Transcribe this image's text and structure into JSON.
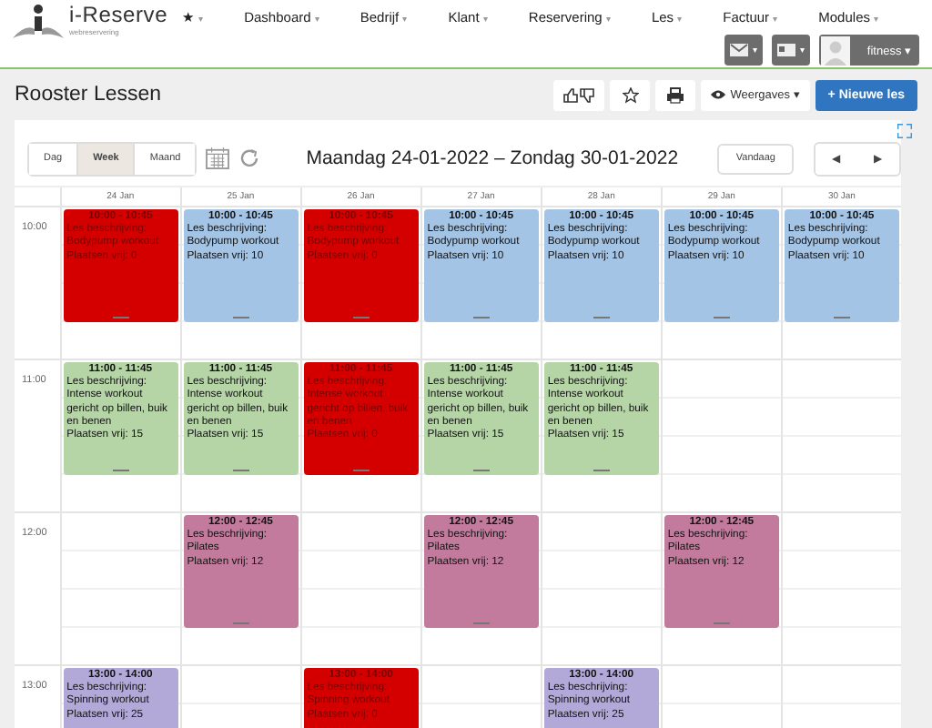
{
  "brand": {
    "name": "i-Reserve",
    "tagline": "webreservering"
  },
  "nav": [
    {
      "label": "★",
      "caret": "▾"
    },
    {
      "label": "Dashboard",
      "caret": "▾"
    },
    {
      "label": "Bedrijf",
      "caret": "▾"
    },
    {
      "label": "Klant",
      "caret": "▾"
    },
    {
      "label": "Reservering",
      "caret": "▾"
    },
    {
      "label": "Les",
      "caret": "▾"
    },
    {
      "label": "Factuur",
      "caret": "▾"
    },
    {
      "label": "Modules",
      "caret": "▾"
    }
  ],
  "user": {
    "name": "fitness",
    "caret": "▾"
  },
  "page": {
    "title": "Rooster Lessen",
    "views_button": "Weergaves",
    "views_caret": "▾",
    "new_button": "+ Nieuwe les"
  },
  "calendar": {
    "view_tabs": [
      {
        "label": "Dag",
        "selected": false
      },
      {
        "label": "Week",
        "selected": true
      },
      {
        "label": "Maand",
        "selected": false
      }
    ],
    "range": "Maandag 24-01-2022 – Zondag 30-01-2022",
    "today_button": "Vandaag",
    "prev": "◀",
    "next": "▶",
    "hours": [
      "10:00",
      "11:00",
      "12:00",
      "13:00"
    ],
    "days": [
      {
        "label": "24 Jan",
        "slots": [
          {
            "kind": "lesson",
            "time": "10:00 - 10:45",
            "lines": [
              "Les beschrijving:",
              "Bodypump workout",
              "Plaatsen vrij: 0"
            ],
            "color": "#d40000",
            "full": true
          },
          {
            "kind": "lesson",
            "time": "11:00 - 11:45",
            "lines": [
              "Les beschrijving:",
              "Intense workout gericht op billen, buik en benen",
              "Plaatsen vrij: 15"
            ],
            "color": "#b5d5a7",
            "full": false
          },
          {
            "kind": "empty"
          },
          {
            "kind": "lesson",
            "time": "13:00 - 14:00",
            "lines": [
              "Les beschrijving:",
              "Spinning workout",
              "Plaatsen vrij: 25"
            ],
            "color": "#b3a9d9",
            "full": false
          }
        ]
      },
      {
        "label": "25 Jan",
        "slots": [
          {
            "kind": "lesson",
            "time": "10:00 - 10:45",
            "lines": [
              "Les beschrijving:",
              "Bodypump workout",
              "Plaatsen vrij: 10"
            ],
            "color": "#a4c4e6",
            "full": false
          },
          {
            "kind": "lesson",
            "time": "11:00 - 11:45",
            "lines": [
              "Les beschrijving:",
              "Intense workout gericht op billen, buik en benen",
              "Plaatsen vrij: 15"
            ],
            "color": "#b5d5a7",
            "full": false
          },
          {
            "kind": "lesson",
            "time": "12:00 - 12:45",
            "lines": [
              "Les beschrijving:",
              "Pilates",
              "Plaatsen vrij: 12"
            ],
            "color": "#c27b9c",
            "full": false
          },
          {
            "kind": "empty"
          }
        ]
      },
      {
        "label": "26 Jan",
        "slots": [
          {
            "kind": "lesson",
            "time": "10:00 - 10:45",
            "lines": [
              "Les beschrijving:",
              "Bodypump workout",
              "Plaatsen vrij: 0"
            ],
            "color": "#d40000",
            "full": true
          },
          {
            "kind": "lesson",
            "time": "11:00 - 11:45",
            "lines": [
              "Les beschrijving:",
              "Intense workout gericht op billen, buik en benen",
              "Plaatsen vrij: 0"
            ],
            "color": "#d40000",
            "full": true
          },
          {
            "kind": "empty"
          },
          {
            "kind": "lesson",
            "time": "13:00 - 14:00",
            "lines": [
              "Les beschrijving:",
              "Spinning workout",
              "Plaatsen vrij: 0"
            ],
            "color": "#d40000",
            "full": true
          }
        ]
      },
      {
        "label": "27 Jan",
        "slots": [
          {
            "kind": "lesson",
            "time": "10:00 - 10:45",
            "lines": [
              "Les beschrijving:",
              "Bodypump workout",
              "Plaatsen vrij: 10"
            ],
            "color": "#a4c4e6",
            "full": false
          },
          {
            "kind": "lesson",
            "time": "11:00 - 11:45",
            "lines": [
              "Les beschrijving:",
              "Intense workout gericht op billen, buik en benen",
              "Plaatsen vrij: 15"
            ],
            "color": "#b5d5a7",
            "full": false
          },
          {
            "kind": "lesson",
            "time": "12:00 - 12:45",
            "lines": [
              "Les beschrijving:",
              "Pilates",
              "Plaatsen vrij: 12"
            ],
            "color": "#c27b9c",
            "full": false
          },
          {
            "kind": "empty"
          }
        ]
      },
      {
        "label": "28 Jan",
        "slots": [
          {
            "kind": "lesson",
            "time": "10:00 - 10:45",
            "lines": [
              "Les beschrijving:",
              "Bodypump workout",
              "Plaatsen vrij: 10"
            ],
            "color": "#a4c4e6",
            "full": false
          },
          {
            "kind": "lesson",
            "time": "11:00 - 11:45",
            "lines": [
              "Les beschrijving:",
              "Intense workout gericht op billen, buik en benen",
              "Plaatsen vrij: 15"
            ],
            "color": "#b5d5a7",
            "full": false
          },
          {
            "kind": "empty"
          },
          {
            "kind": "lesson",
            "time": "13:00 - 14:00",
            "lines": [
              "Les beschrijving:",
              "Spinning workout",
              "Plaatsen vrij: 25"
            ],
            "color": "#b3a9d9",
            "full": false
          }
        ]
      },
      {
        "label": "29 Jan",
        "slots": [
          {
            "kind": "lesson",
            "time": "10:00 - 10:45",
            "lines": [
              "Les beschrijving:",
              "Bodypump workout",
              "Plaatsen vrij: 10"
            ],
            "color": "#a4c4e6",
            "full": false
          },
          {
            "kind": "empty"
          },
          {
            "kind": "lesson",
            "time": "12:00 - 12:45",
            "lines": [
              "Les beschrijving:",
              "Pilates",
              "Plaatsen vrij: 12"
            ],
            "color": "#c27b9c",
            "full": false
          },
          {
            "kind": "empty"
          }
        ]
      },
      {
        "label": "30 Jan",
        "slots": [
          {
            "kind": "lesson",
            "time": "10:00 - 10:45",
            "lines": [
              "Les beschrijving:",
              "Bodypump workout",
              "Plaatsen vrij: 10"
            ],
            "color": "#a4c4e6",
            "full": false
          },
          {
            "kind": "empty"
          },
          {
            "kind": "empty"
          },
          {
            "kind": "empty"
          }
        ]
      }
    ]
  }
}
